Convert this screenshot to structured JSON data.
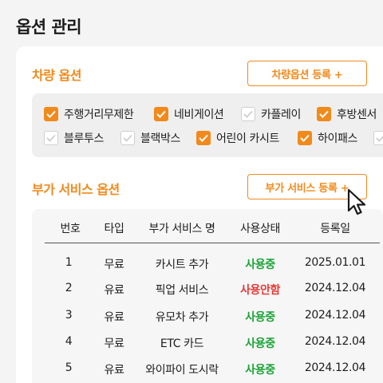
{
  "page": {
    "title": "옵션 관리"
  },
  "vehicle_options": {
    "title": "차량 옵션",
    "register_label": "차량옵션 등록 +",
    "items": [
      {
        "label": "주행거리무제한",
        "checked": true
      },
      {
        "label": "네비게이션",
        "checked": true
      },
      {
        "label": "카플레이",
        "checked": false
      },
      {
        "label": "후방센서",
        "checked": true
      },
      {
        "label": "블루투스",
        "checked": false
      },
      {
        "label": "블랙박스",
        "checked": false
      },
      {
        "label": "어린이 카시트",
        "checked": true
      },
      {
        "label": "하이패스",
        "checked": true
      },
      {
        "label": "",
        "checked": false
      }
    ]
  },
  "addon_services": {
    "title": "부가 서비스 옵션",
    "register_label": "부가 서비스 등록 +",
    "columns": [
      "번호",
      "타입",
      "부가 서비스 명",
      "사용상태",
      "등록일"
    ],
    "rows": [
      {
        "no": "1",
        "type": "무료",
        "name": "카시트 추가",
        "status": "사용중",
        "active": true,
        "date": "2025.01.01"
      },
      {
        "no": "2",
        "type": "유료",
        "name": "픽업 서비스",
        "status": "사용안함",
        "active": false,
        "date": "2024.12.04"
      },
      {
        "no": "3",
        "type": "유료",
        "name": "유모차 추가",
        "status": "사용중",
        "active": true,
        "date": "2024.12.04"
      },
      {
        "no": "4",
        "type": "무료",
        "name": "ETC 카드",
        "status": "사용중",
        "active": true,
        "date": "2024.12.04"
      },
      {
        "no": "5",
        "type": "유료",
        "name": "와이파이 도시락",
        "status": "사용중",
        "active": true,
        "date": "2024.12.04"
      }
    ]
  },
  "colors": {
    "accent": "#f08a1c",
    "active": "#1aa336",
    "inactive": "#e53935"
  },
  "icons": {
    "checkbox": "check-icon",
    "cursor": "mouse-pointer-icon"
  }
}
